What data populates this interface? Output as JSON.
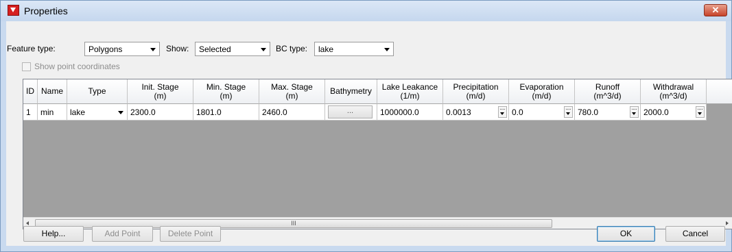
{
  "window": {
    "title": "Properties",
    "close_label": "✕"
  },
  "filters": {
    "feature_type_label": "Feature type:",
    "feature_type_value": "Polygons",
    "show_label": "Show:",
    "show_value": "Selected",
    "bc_type_label": "BC type:",
    "bc_type_value": "lake"
  },
  "show_point_coordinates": {
    "label": "Show point coordinates",
    "checked": false,
    "enabled": false
  },
  "table": {
    "headers": [
      [
        "ID"
      ],
      [
        "Name"
      ],
      [
        "Type"
      ],
      [
        "Init. Stage",
        "(m)"
      ],
      [
        "Min. Stage",
        "(m)"
      ],
      [
        "Max. Stage",
        "(m)"
      ],
      [
        "Bathymetry"
      ],
      [
        "Lake Leakance",
        "(1/m)"
      ],
      [
        "Precipitation",
        "(m/d)"
      ],
      [
        "Evaporation",
        "(m/d)"
      ],
      [
        "Runoff",
        "(m^3/d)"
      ],
      [
        "Withdrawal",
        "(m^3/d)"
      ]
    ],
    "rows": [
      {
        "id": "1",
        "name": "min",
        "type": "lake",
        "init_stage": "2300.0",
        "min_stage": "1801.0",
        "max_stage": "2460.0",
        "bathymetry": "...",
        "lake_leakance": "1000000.0",
        "precipitation": "0.0013",
        "evaporation": "0.0",
        "runoff": "780.0",
        "withdrawal": "2000.0"
      }
    ],
    "scroll_thumb_grip": "III"
  },
  "buttons": {
    "help": "Help...",
    "add_point": "Add Point",
    "delete_point": "Delete Point",
    "ok": "OK",
    "cancel": "Cancel"
  },
  "colors": {
    "window_frame": "#c9daef",
    "client": "#f0f0f0",
    "grid_empty": "#a0a0a0",
    "close_red": "#c7432a"
  },
  "icons": {
    "title": "app-logo-icon",
    "close": "close-icon"
  }
}
